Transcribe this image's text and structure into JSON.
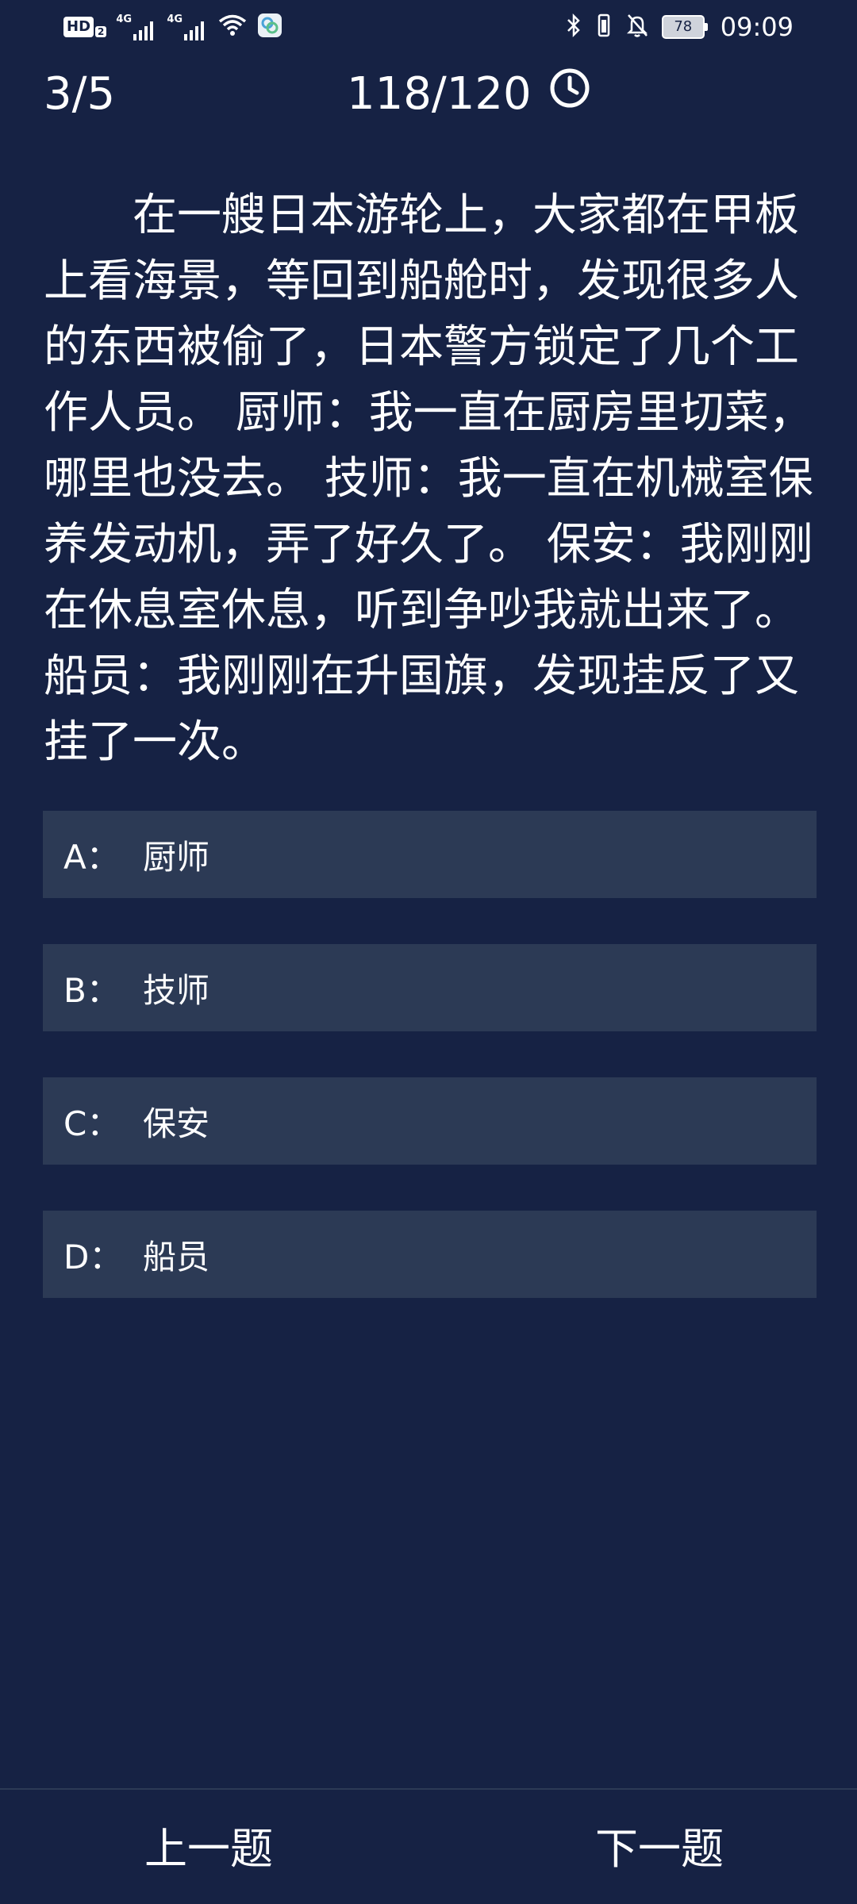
{
  "status_bar": {
    "hd_label": "HD",
    "hd_sub": "2",
    "network_1": "4G",
    "network_2": "4G",
    "battery_level": "78",
    "time": "09:09",
    "icons": [
      "signal-icon",
      "wifi-icon",
      "app-icon",
      "bluetooth-icon",
      "vibrate-icon",
      "bell-off-icon",
      "battery-icon"
    ]
  },
  "header": {
    "progress": "3/5",
    "timer": "118/120",
    "timer_icon": "clock-icon"
  },
  "question": {
    "text": "在一艘日本游轮上，大家都在甲板上看海景，等回到船舱时，发现很多人的东西被偷了，日本警方锁定了几个工作人员。 厨师：我一直在厨房里切菜，哪里也没去。 技师：我一直在机械室保养发动机，弄了好久了。 保安：我刚刚在休息室休息，听到争吵我就出来了。 船员：我刚刚在升国旗，发现挂反了又挂了一次。"
  },
  "options": [
    {
      "letter": "A：",
      "text": "厨师"
    },
    {
      "letter": "B：",
      "text": "技师"
    },
    {
      "letter": "C：",
      "text": "保安"
    },
    {
      "letter": "D：",
      "text": "船员"
    }
  ],
  "nav": {
    "prev": "上一题",
    "next": "下一题"
  },
  "colors": {
    "background": "#162244",
    "option_bg": "#2c3a55",
    "text": "#ffffff"
  }
}
